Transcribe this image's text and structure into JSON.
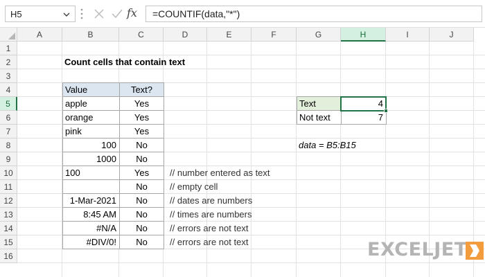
{
  "formula_bar": {
    "name_box": "H5",
    "formula": "=COUNTIF(data,\"*\")",
    "fx_label": "fx"
  },
  "columns": [
    "A",
    "B",
    "C",
    "D",
    "E",
    "F",
    "G",
    "H",
    "I",
    "J"
  ],
  "rows": [
    "1",
    "2",
    "3",
    "4",
    "5",
    "6",
    "7",
    "8",
    "9",
    "10",
    "11",
    "12",
    "13",
    "14",
    "15",
    "16"
  ],
  "active_cell": {
    "column": "H",
    "row": "5"
  },
  "sheet": {
    "title": "Count cells that contain text",
    "table_headers": {
      "value": "Value",
      "text": "Text?"
    },
    "table_rows": [
      {
        "value": "apple",
        "text": "Yes",
        "comment": ""
      },
      {
        "value": "orange",
        "text": "Yes",
        "comment": ""
      },
      {
        "value": "pink",
        "text": "Yes",
        "comment": ""
      },
      {
        "value": "100",
        "text": "No",
        "comment": ""
      },
      {
        "value": "1000",
        "text": "No",
        "comment": ""
      },
      {
        "value": "100",
        "text": "Yes",
        "comment": "// number entered as text"
      },
      {
        "value": "",
        "text": "No",
        "comment": "// empty cell"
      },
      {
        "value": "1-Mar-2021",
        "text": "No",
        "comment": "// dates are numbers"
      },
      {
        "value": "8:45 AM",
        "text": "No",
        "comment": "// times are numbers"
      },
      {
        "value": "#N/A",
        "text": "No",
        "comment": "// errors are not text"
      },
      {
        "value": "#DIV/0!",
        "text": "No",
        "comment": "// errors are not text"
      }
    ],
    "summary": [
      {
        "label": "Text",
        "value": "4"
      },
      {
        "label": "Not text",
        "value": "7"
      }
    ],
    "named_range_note": "data = B5:B15"
  },
  "logo": {
    "text": "EXCELJET"
  },
  "colors": {
    "accent": "#217346",
    "header_blue": "#dce6f1",
    "header_green": "#e2efda",
    "logo_orange": "#f39c3d"
  }
}
